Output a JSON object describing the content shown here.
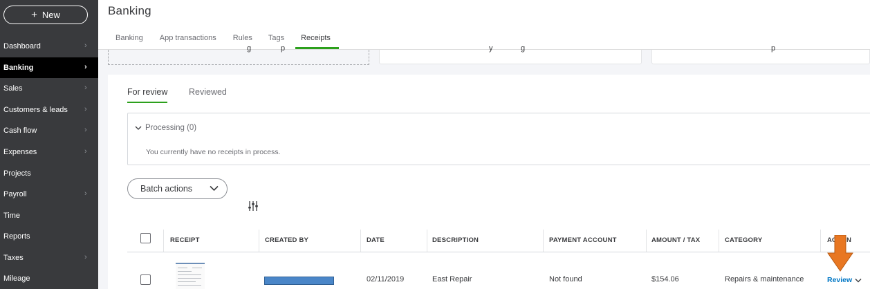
{
  "sidebar": {
    "new_button": {
      "icon": "plus-icon",
      "label": "New"
    },
    "items": [
      {
        "label": "Dashboard",
        "chevron": true
      },
      {
        "label": "Banking",
        "chevron": true,
        "active": true
      },
      {
        "label": "Sales",
        "chevron": true
      },
      {
        "label": "Customers & leads",
        "chevron": true
      },
      {
        "label": "Cash flow",
        "chevron": true
      },
      {
        "label": "Expenses",
        "chevron": true
      },
      {
        "label": "Projects",
        "chevron": false
      },
      {
        "label": "Payroll",
        "chevron": true
      },
      {
        "label": "Time",
        "chevron": false
      },
      {
        "label": "Reports",
        "chevron": false
      },
      {
        "label": "Taxes",
        "chevron": true
      },
      {
        "label": "Mileage",
        "chevron": false
      }
    ]
  },
  "header": {
    "title": "Banking",
    "tabs": [
      {
        "label": "Banking"
      },
      {
        "label": "App transactions"
      },
      {
        "label": "Rules"
      },
      {
        "label": "Tags"
      },
      {
        "label": "Receipts",
        "active": true
      }
    ]
  },
  "main": {
    "subtabs": [
      {
        "label": "For review",
        "active": true
      },
      {
        "label": "Reviewed"
      }
    ],
    "processing": {
      "label": "Processing (0)",
      "message": "You currently have no receipts in process."
    },
    "batch_actions_label": "Batch actions",
    "table": {
      "headers": {
        "receipt": "RECEIPT",
        "created_by": "CREATED BY",
        "date": "DATE",
        "description": "DESCRIPTION",
        "payment_account": "PAYMENT ACCOUNT",
        "amount_tax": "AMOUNT / TAX",
        "category": "CATEGORY",
        "action_left": "AC",
        "action_right": "N"
      },
      "rows": [
        {
          "date": "02/11/2019",
          "description": "East Repair",
          "payment_account": "Not found",
          "amount": "$154.06",
          "category": "Repairs & maintenance",
          "action": "Review"
        }
      ]
    }
  },
  "colors": {
    "sidebar_bg": "#393a3d",
    "active_tab": "#2ca01c",
    "link": "#0077c5",
    "annotation_arrow": "#e87722"
  }
}
